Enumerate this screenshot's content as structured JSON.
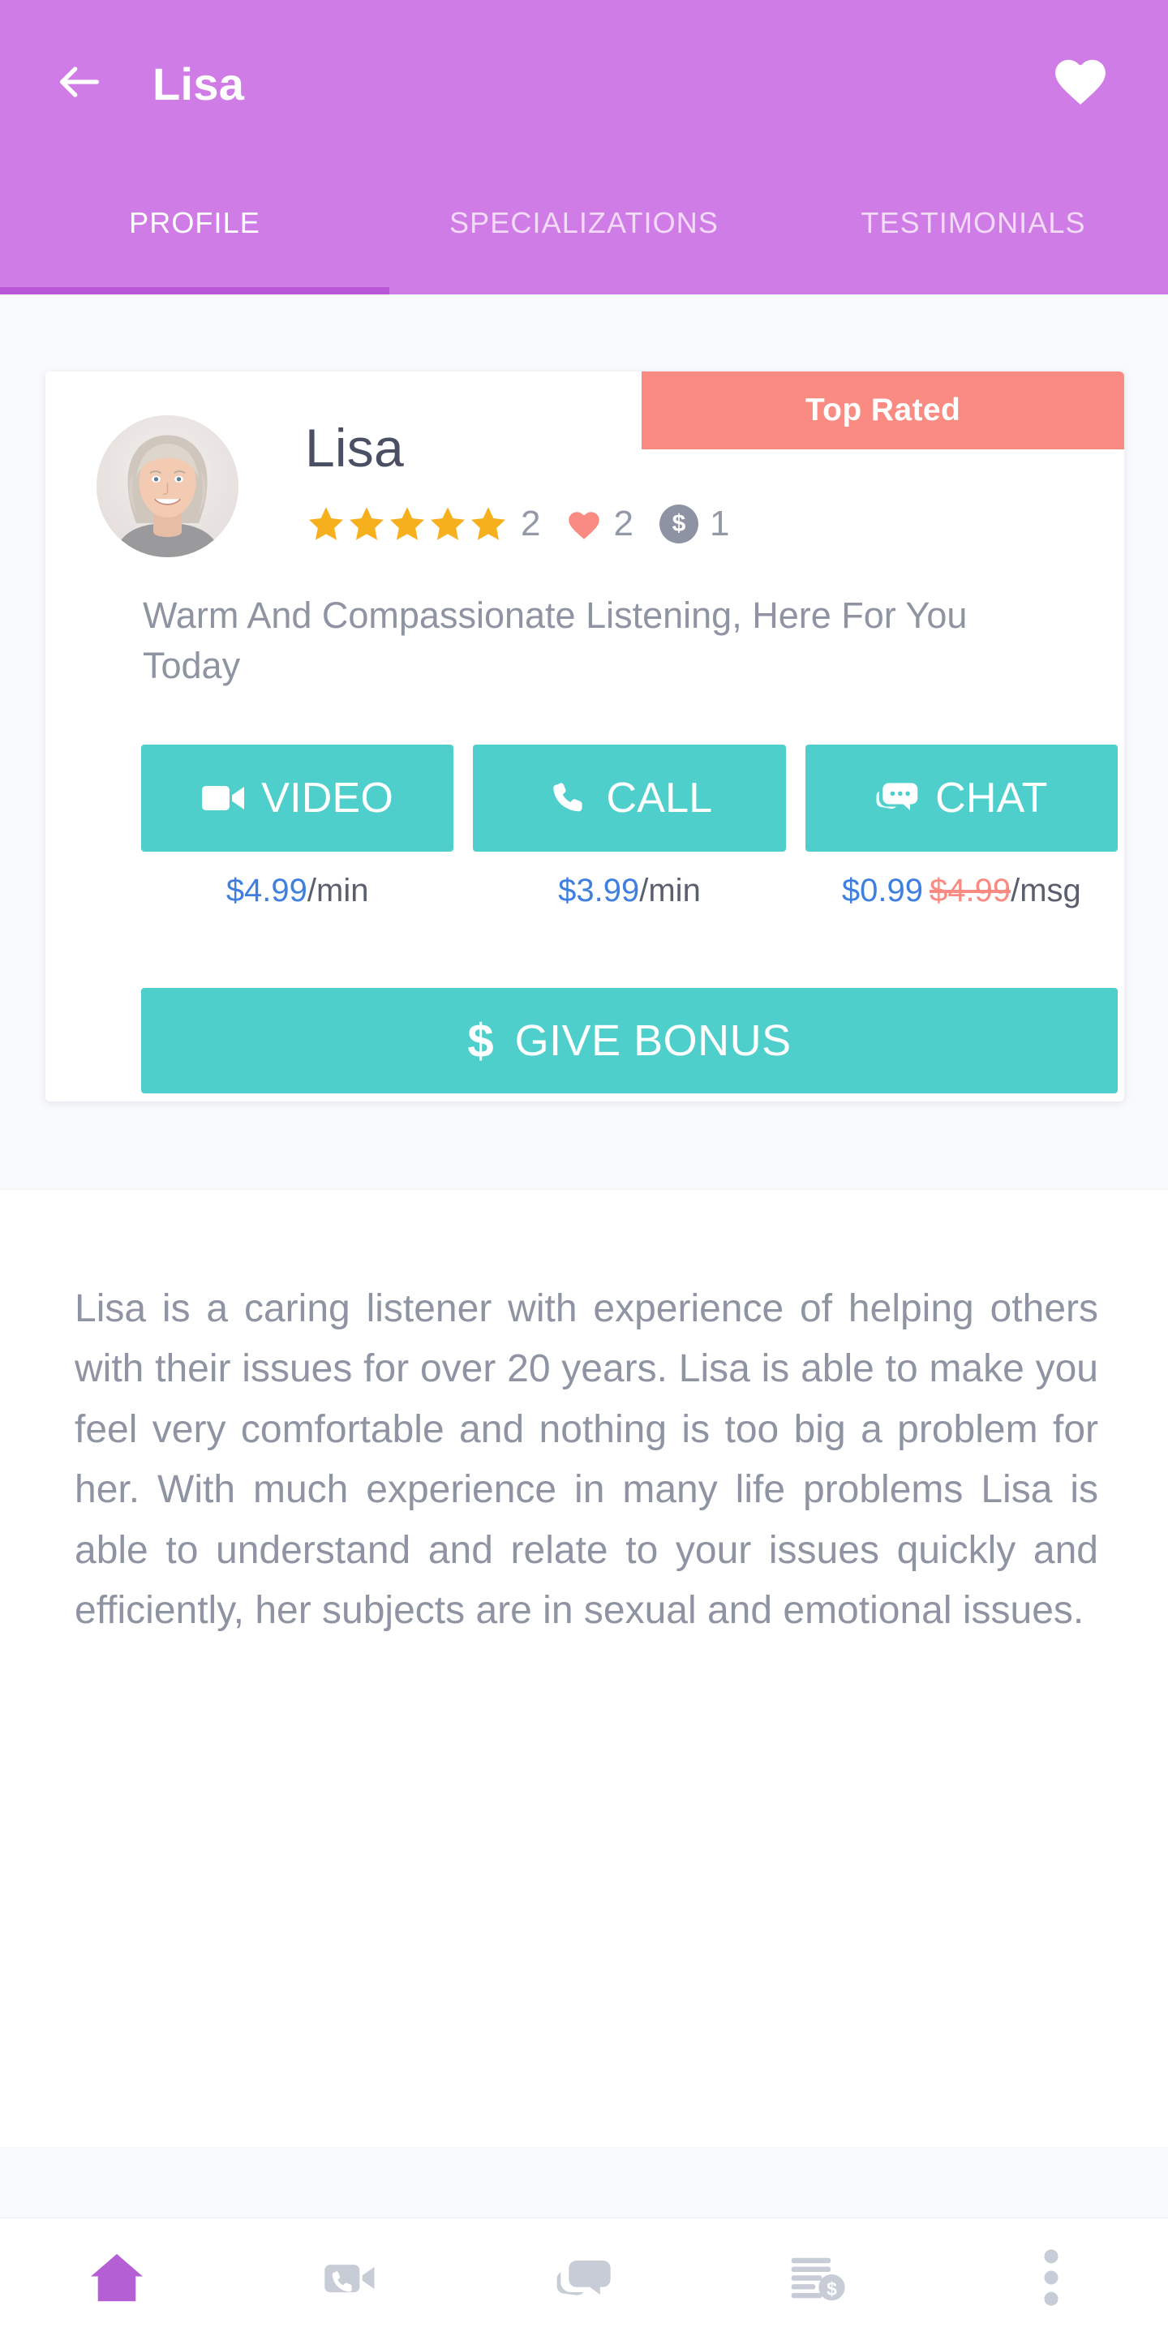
{
  "header": {
    "title": "Lisa",
    "back_icon": "arrow-left-icon",
    "favorite_icon": "heart-filled-icon",
    "background_color": "#d07ce6",
    "indicator_color": "#b957d6"
  },
  "tabs": [
    {
      "label": "PROFILE",
      "active": true
    },
    {
      "label": "SPECIALIZATIONS",
      "active": false
    },
    {
      "label": "TESTIMONIALS",
      "active": false
    }
  ],
  "profile": {
    "badge": {
      "label": "Top Rated",
      "color": "#fa8b82"
    },
    "name": "Lisa",
    "avatar_alt": "avatar-photo",
    "stats": {
      "star_count": 5,
      "star_color": "#f6b01e",
      "reviews": "2",
      "likes": "2",
      "likes_icon": "heart-icon",
      "likes_color": "#fa8b82",
      "coins": "1",
      "coins_icon": "dollar-badge-icon",
      "coins_color": "#8e93a3"
    },
    "tagline": "Warm And Compassionate Listening, Here For You Today",
    "actions": [
      {
        "label": "VIDEO",
        "icon": "video-camera-icon",
        "price_amount": "$4.99",
        "price_old": "",
        "price_unit": "/min"
      },
      {
        "label": "CALL",
        "icon": "phone-icon",
        "price_amount": "$3.99",
        "price_old": "",
        "price_unit": "/min"
      },
      {
        "label": "CHAT",
        "icon": "chat-bubbles-icon",
        "price_amount": "$0.99",
        "price_old": "$4.99",
        "price_unit": "/msg"
      }
    ],
    "bonus": {
      "label": "GIVE BONUS",
      "icon": "dollar-sign-icon",
      "symbol": "$"
    },
    "action_color": "#4ecfcc",
    "price_color": "#3f7fe0"
  },
  "bio": {
    "text": "Lisa is a caring listener with experience of helping others with their issues for over 20 years. Lisa is able to make you feel very comfortable and nothing is too big a problem for her. With much experience in many life problems Lisa is able to understand and relate to your issues quickly and efficiently, her subjects are in sexual and emotional issues."
  },
  "bottom_nav": [
    {
      "icon": "home-icon",
      "active": true
    },
    {
      "icon": "video-call-icon",
      "active": false
    },
    {
      "icon": "chat-icon",
      "active": false
    },
    {
      "icon": "billing-icon",
      "active": false
    },
    {
      "icon": "more-vertical-icon",
      "active": false
    }
  ],
  "colors": {
    "accent_purple": "#d07ce6",
    "accent_purple_dark": "#b957d6",
    "teal": "#4ecfcc",
    "salmon": "#fa8b82",
    "star_gold": "#f6b01e",
    "link_blue": "#3f7fe0",
    "muted_text": "#8f94a3",
    "nav_inactive": "#c7ccd6",
    "page_bg": "#f8fafc"
  }
}
